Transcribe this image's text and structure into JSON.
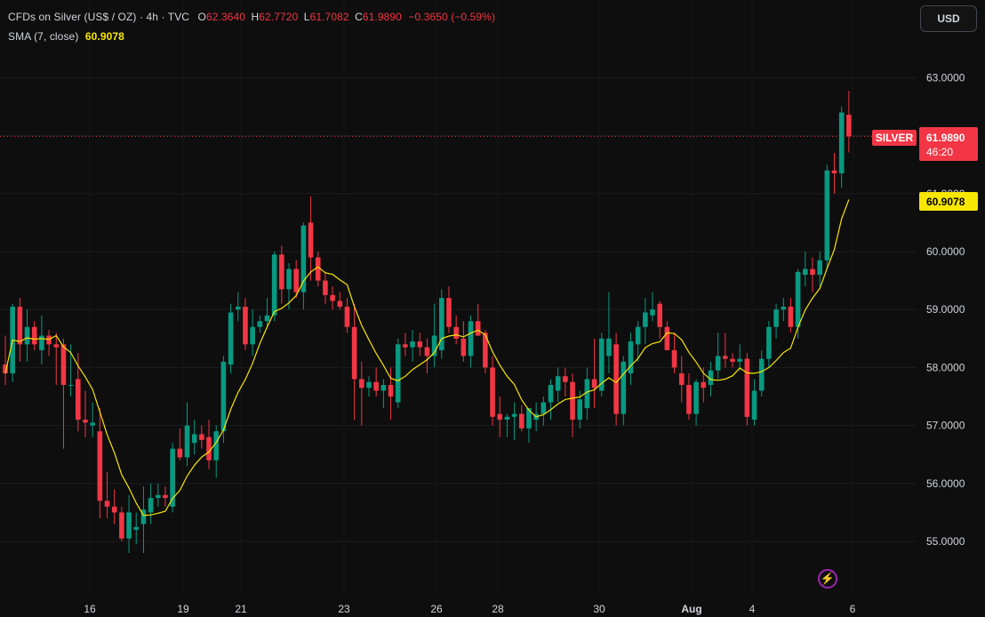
{
  "legend": {
    "title": "CFDs on Silver (US$ / OZ) · 4h · TVC",
    "o_label": "O",
    "o": "62.3640",
    "h_label": "H",
    "h": "62.7720",
    "l_label": "L",
    "l": "61.7082",
    "c_label": "C",
    "c": "61.9890",
    "change": "−0.3650 (−0.59%)",
    "sma_label": "SMA (7, close)",
    "sma_value": "60.9078"
  },
  "currency_button": "USD",
  "price_tag": {
    "symbol": "SILVER",
    "price": "61.9890",
    "countdown": "46:20"
  },
  "sma_tag": "60.9078",
  "colors": {
    "up": "#089981",
    "down": "#f23645",
    "sma": "#f7e600",
    "grid": "#1c1c1c",
    "text": "#d1d4dc",
    "bg": "#0e0e0e"
  },
  "icons": {
    "bolt": "lightning-bolt-icon"
  },
  "chart_data": {
    "type": "candlestick",
    "ylim": [
      54.5,
      63.5
    ],
    "y_ticks": [
      "55.0000",
      "56.0000",
      "57.0000",
      "58.0000",
      "59.0000",
      "60.0000",
      "61.0000",
      "62.0000",
      "63.0000"
    ],
    "x_ticks": [
      "16",
      "19",
      "21",
      "23",
      "26",
      "28",
      "30",
      "Aug",
      "4",
      "6"
    ],
    "last_price": 61.989,
    "sma_last": 60.9078,
    "ohlc": [
      [
        58.05,
        58.55,
        57.7,
        57.9
      ],
      [
        57.9,
        59.1,
        57.75,
        59.05
      ],
      [
        59.05,
        59.2,
        58.1,
        58.4
      ],
      [
        58.4,
        59.0,
        58.1,
        58.7
      ],
      [
        58.7,
        58.8,
        58.3,
        58.4
      ],
      [
        58.3,
        58.9,
        58.05,
        58.55
      ],
      [
        58.55,
        58.65,
        58.2,
        58.4
      ],
      [
        58.4,
        58.6,
        57.7,
        58.35
      ],
      [
        58.4,
        58.5,
        56.6,
        57.7
      ],
      [
        57.7,
        58.4,
        57.5,
        57.7
      ],
      [
        57.8,
        58.25,
        56.9,
        57.1
      ],
      [
        57.1,
        57.6,
        56.8,
        57.05
      ],
      [
        57.0,
        57.4,
        56.8,
        57.05
      ],
      [
        56.9,
        57.3,
        55.4,
        55.7
      ],
      [
        55.7,
        56.2,
        55.4,
        55.6
      ],
      [
        55.6,
        55.9,
        55.3,
        55.5
      ],
      [
        55.5,
        55.6,
        55.0,
        55.05
      ],
      [
        55.05,
        55.8,
        54.8,
        55.5
      ],
      [
        55.2,
        55.5,
        54.95,
        55.25
      ],
      [
        55.3,
        55.95,
        54.8,
        55.55
      ],
      [
        55.5,
        56.0,
        55.3,
        55.75
      ],
      [
        55.75,
        56.0,
        55.6,
        55.8
      ],
      [
        55.8,
        55.95,
        55.6,
        55.75
      ],
      [
        55.6,
        56.7,
        55.5,
        56.6
      ],
      [
        56.6,
        56.95,
        56.4,
        56.45
      ],
      [
        56.45,
        57.4,
        56.3,
        57.0
      ],
      [
        56.7,
        57.1,
        56.5,
        56.85
      ],
      [
        56.85,
        57.0,
        56.6,
        56.75
      ],
      [
        56.8,
        57.1,
        56.25,
        56.4
      ],
      [
        56.4,
        57.0,
        56.1,
        56.9
      ],
      [
        56.9,
        58.2,
        56.7,
        58.1
      ],
      [
        58.05,
        59.1,
        57.9,
        58.95
      ],
      [
        59.0,
        59.3,
        58.8,
        59.05
      ],
      [
        59.05,
        59.2,
        58.3,
        58.4
      ],
      [
        58.4,
        59.0,
        58.2,
        58.7
      ],
      [
        58.7,
        58.9,
        58.6,
        58.8
      ],
      [
        58.8,
        59.2,
        58.7,
        58.9
      ],
      [
        58.9,
        60.0,
        58.8,
        59.95
      ],
      [
        59.95,
        60.1,
        59.1,
        59.35
      ],
      [
        59.35,
        59.8,
        59.0,
        59.7
      ],
      [
        59.7,
        59.85,
        59.2,
        59.3
      ],
      [
        59.3,
        60.5,
        59.0,
        60.45
      ],
      [
        60.5,
        60.95,
        59.5,
        59.9
      ],
      [
        59.9,
        60.0,
        59.4,
        59.5
      ],
      [
        59.5,
        59.65,
        59.1,
        59.25
      ],
      [
        59.25,
        59.4,
        59.0,
        59.15
      ],
      [
        59.15,
        59.3,
        59.0,
        59.05
      ],
      [
        59.05,
        59.2,
        58.6,
        58.7
      ],
      [
        58.7,
        59.1,
        57.1,
        57.8
      ],
      [
        57.8,
        58.1,
        57.0,
        57.65
      ],
      [
        57.65,
        57.85,
        57.5,
        57.75
      ],
      [
        57.75,
        58.0,
        57.5,
        57.6
      ],
      [
        57.6,
        57.8,
        57.3,
        57.7
      ],
      [
        57.7,
        58.0,
        57.1,
        57.5
      ],
      [
        57.4,
        58.5,
        57.3,
        58.4
      ],
      [
        58.4,
        58.6,
        58.2,
        58.35
      ],
      [
        58.35,
        58.65,
        58.1,
        58.45
      ],
      [
        58.45,
        58.6,
        58.2,
        58.35
      ],
      [
        58.35,
        58.5,
        57.9,
        58.2
      ],
      [
        58.2,
        59.1,
        58.0,
        58.55
      ],
      [
        58.3,
        59.35,
        58.15,
        59.2
      ],
      [
        59.2,
        59.4,
        58.6,
        58.7
      ],
      [
        58.7,
        58.9,
        58.4,
        58.5
      ],
      [
        58.5,
        58.8,
        58.1,
        58.2
      ],
      [
        58.2,
        58.9,
        58.0,
        58.8
      ],
      [
        58.8,
        59.1,
        58.6,
        58.55
      ],
      [
        58.6,
        58.65,
        57.9,
        58.0
      ],
      [
        58.0,
        58.2,
        57.0,
        57.15
      ],
      [
        57.2,
        57.5,
        56.8,
        57.1
      ],
      [
        57.1,
        57.2,
        56.8,
        57.15
      ],
      [
        57.15,
        57.4,
        56.75,
        57.2
      ],
      [
        57.2,
        57.35,
        56.9,
        56.95
      ],
      [
        56.95,
        57.2,
        56.7,
        57.3
      ],
      [
        57.1,
        57.4,
        56.9,
        57.2
      ],
      [
        57.2,
        57.5,
        57.0,
        57.4
      ],
      [
        57.4,
        57.8,
        57.1,
        57.7
      ],
      [
        57.6,
        58.0,
        57.4,
        57.85
      ],
      [
        57.85,
        58.0,
        57.5,
        57.75
      ],
      [
        57.75,
        57.9,
        56.8,
        57.1
      ],
      [
        57.1,
        57.6,
        56.95,
        57.45
      ],
      [
        57.3,
        58.0,
        57.1,
        57.8
      ],
      [
        57.8,
        58.5,
        57.3,
        57.65
      ],
      [
        57.6,
        58.6,
        57.5,
        58.5
      ],
      [
        58.2,
        59.3,
        57.9,
        58.5
      ],
      [
        58.4,
        58.6,
        57.0,
        57.2
      ],
      [
        57.2,
        58.2,
        57.0,
        58.1
      ],
      [
        57.9,
        58.6,
        57.7,
        58.45
      ],
      [
        58.4,
        58.8,
        58.1,
        58.7
      ],
      [
        58.7,
        59.2,
        58.4,
        58.95
      ],
      [
        58.9,
        59.3,
        58.8,
        59.0
      ],
      [
        59.1,
        59.15,
        58.5,
        58.7
      ],
      [
        58.7,
        58.8,
        58.3,
        58.3
      ],
      [
        58.3,
        58.6,
        57.9,
        58.0
      ],
      [
        57.9,
        58.2,
        57.4,
        57.7
      ],
      [
        57.7,
        57.9,
        57.1,
        57.2
      ],
      [
        57.2,
        57.8,
        57.0,
        57.75
      ],
      [
        57.75,
        58.0,
        57.4,
        57.65
      ],
      [
        57.7,
        58.1,
        57.5,
        57.95
      ],
      [
        57.95,
        58.6,
        57.8,
        58.2
      ],
      [
        58.2,
        58.6,
        58.0,
        58.15
      ],
      [
        58.15,
        58.25,
        58.0,
        58.1
      ],
      [
        58.1,
        58.4,
        57.95,
        58.15
      ],
      [
        58.15,
        58.25,
        57.0,
        57.15
      ],
      [
        57.1,
        57.8,
        57.0,
        57.6
      ],
      [
        57.6,
        58.3,
        57.5,
        58.15
      ],
      [
        58.15,
        58.8,
        58.0,
        58.7
      ],
      [
        58.7,
        59.1,
        58.5,
        59.0
      ],
      [
        59.0,
        59.2,
        58.8,
        59.05
      ],
      [
        59.05,
        59.2,
        58.6,
        58.7
      ],
      [
        58.7,
        59.7,
        58.5,
        59.65
      ],
      [
        59.6,
        60.0,
        59.4,
        59.7
      ],
      [
        59.7,
        59.9,
        59.3,
        59.6
      ],
      [
        59.6,
        60.0,
        59.4,
        59.85
      ],
      [
        59.85,
        61.5,
        59.7,
        61.4
      ],
      [
        61.4,
        61.7,
        61.0,
        61.35
      ],
      [
        61.35,
        62.5,
        61.1,
        62.4
      ],
      [
        62.36,
        62.77,
        61.71,
        61.99
      ]
    ]
  }
}
